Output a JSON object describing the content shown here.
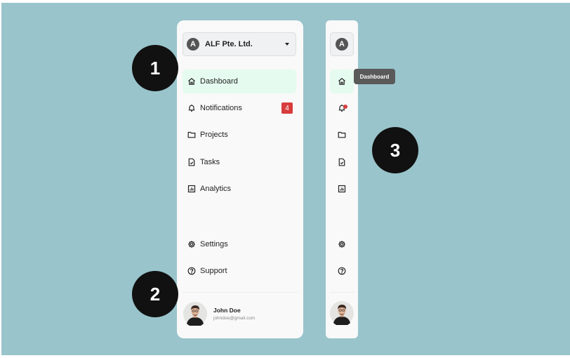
{
  "colors": {
    "backdrop": "#99c4cb",
    "panel": "#f9f9f9",
    "active": "#e5fbef",
    "badge": "#d83c3c",
    "tooltip": "#5a5a5a",
    "callout": "#111111"
  },
  "org": {
    "initial": "A",
    "name": "ALF Pte. Ltd.",
    "icon": "chevron-down-icon"
  },
  "nav": [
    {
      "label": "Dashboard",
      "icon": "home-icon",
      "active": true
    },
    {
      "label": "Notifications",
      "icon": "bell-icon",
      "badge": "4"
    },
    {
      "label": "Projects",
      "icon": "folder-icon"
    },
    {
      "label": "Tasks",
      "icon": "task-file-icon"
    },
    {
      "label": "Analytics",
      "icon": "analytics-icon"
    }
  ],
  "footer_nav": [
    {
      "label": "Settings",
      "icon": "gear-icon"
    },
    {
      "label": "Support",
      "icon": "help-icon"
    }
  ],
  "user": {
    "name": "John Doe",
    "email": "johndoe@gmail.com"
  },
  "collapsed": {
    "tooltip": "Dashboard"
  },
  "callouts": [
    "1",
    "2",
    "3"
  ]
}
